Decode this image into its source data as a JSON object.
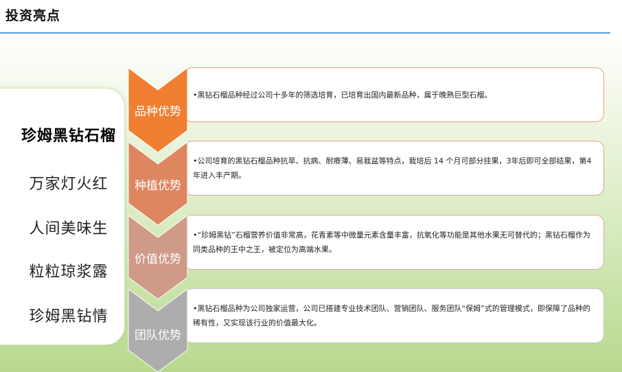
{
  "header": {
    "title": "投资亮点"
  },
  "left_panel": {
    "items": [
      "珍姆黑钻石榴",
      "万家灯火红",
      "人间美味生",
      "粒粒琼浆露",
      "珍姆黑钻情"
    ]
  },
  "highlights": [
    {
      "label": "品种优势",
      "color": "#f07f32",
      "text": "•黑钻石榴品种经过公司十多年的筛选培育，已培育出国内最新品种，属于晚熟巨型石榴。"
    },
    {
      "label": "种植优势",
      "color": "#de8660",
      "text": "•公司培育的黑钻石榴品种抗旱、抗病、耐瘠薄、易栽盆等特点，栽培后 14 个月可部分挂果，3年后即可全部结果，第4年进入丰产期。"
    },
    {
      "label": "价值优势",
      "color": "#cf9a87",
      "text": "•“珍姆黑钻”石榴营养价值非常高，花青素等中微量元素含量丰富，抗氧化等功能是其他水果无可替代的；黑钻石榴作为同类品种的王中之王，被定位为高端水果。"
    },
    {
      "label": "团队优势",
      "color": "#adadad",
      "text": "•黑钻石榴品种为公司独家运营，公司已搭建专业技术团队、营销团队、服务团队“保姆”式的管理模式，即保障了品种的稀有性，又实现该行业的价值最大化。"
    }
  ]
}
